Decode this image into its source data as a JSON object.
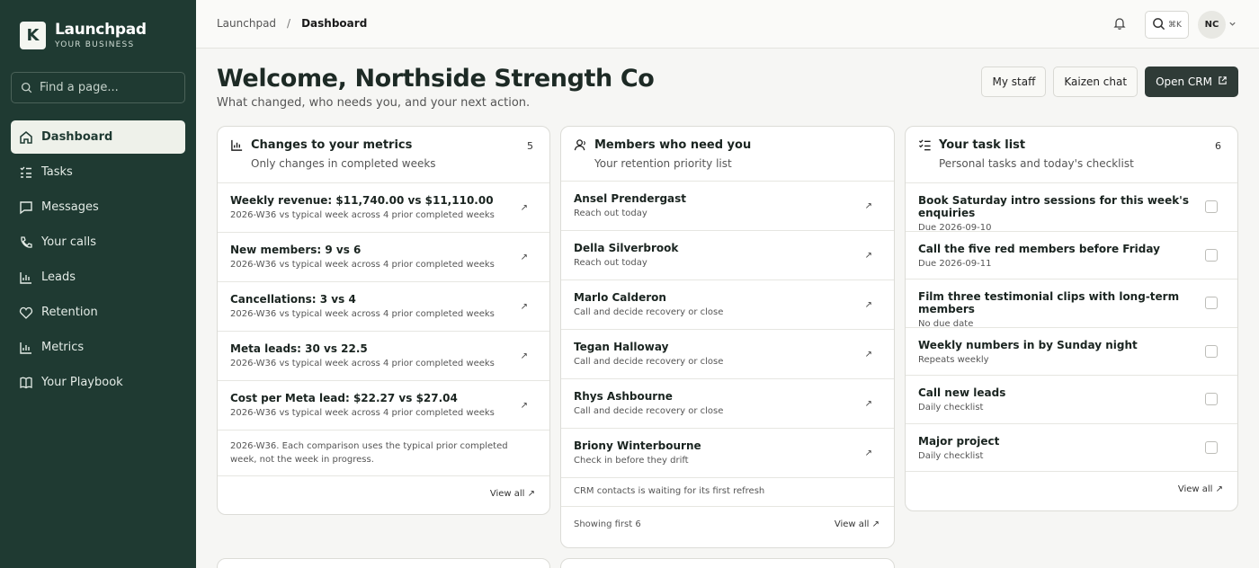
{
  "brand": {
    "logo_letter": "K",
    "name": "Launchpad",
    "tagline": "YOUR BUSINESS"
  },
  "sidebar": {
    "search_placeholder": "Find a page...",
    "items": [
      {
        "label": "Dashboard",
        "icon": "home-icon",
        "active": true
      },
      {
        "label": "Tasks",
        "icon": "tasks-icon"
      },
      {
        "label": "Messages",
        "icon": "message-icon"
      },
      {
        "label": "Your calls",
        "icon": "phone-icon"
      },
      {
        "label": "Leads",
        "icon": "bar-chart-icon"
      },
      {
        "label": "Retention",
        "icon": "heart-icon"
      },
      {
        "label": "Metrics",
        "icon": "bar-chart-icon"
      },
      {
        "label": "Your Playbook",
        "icon": "book-icon"
      }
    ]
  },
  "topbar": {
    "breadcrumb": [
      "Launchpad",
      "Dashboard"
    ],
    "separator": "/",
    "shortcut": "⌘K",
    "avatar_initials": "NC"
  },
  "header": {
    "title": "Welcome, Northside Strength Co",
    "subtitle": "What changed, who needs you, and your next action.",
    "buttons": [
      "My staff",
      "Kaizen chat",
      "Open CRM"
    ]
  },
  "metrics_card": {
    "title": "Changes to your metrics",
    "subtitle": "Only changes in completed weeks",
    "count": "5",
    "rows": [
      {
        "title": "Weekly revenue: $11,740.00 vs $11,110.00",
        "sub": "2026-W36 vs typical week across 4 prior completed weeks"
      },
      {
        "title": "New members: 9 vs 6",
        "sub": "2026-W36 vs typical week across 4 prior completed weeks"
      },
      {
        "title": "Cancellations: 3 vs 4",
        "sub": "2026-W36 vs typical week across 4 prior completed weeks"
      },
      {
        "title": "Meta leads: 30 vs 22.5",
        "sub": "2026-W36 vs typical week across 4 prior completed weeks"
      },
      {
        "title": "Cost per Meta lead: $22.27 vs $27.04",
        "sub": "2026-W36 vs typical week across 4 prior completed weeks"
      }
    ],
    "note": "2026-W36. Each comparison uses the typical prior completed week, not the week in progress.",
    "view_all": "View all"
  },
  "members_card": {
    "title": "Members who need you",
    "subtitle": "Your retention priority list",
    "rows": [
      {
        "title": "Ansel Prendergast",
        "sub": "Reach out today"
      },
      {
        "title": "Della Silverbrook",
        "sub": "Reach out today"
      },
      {
        "title": "Marlo Calderon",
        "sub": "Call and decide recovery or close"
      },
      {
        "title": "Tegan Halloway",
        "sub": "Call and decide recovery or close"
      },
      {
        "title": "Rhys Ashbourne",
        "sub": "Call and decide recovery or close"
      },
      {
        "title": "Briony Winterbourne",
        "sub": "Check in before they drift"
      }
    ],
    "notice": "CRM contacts is waiting for its first refresh",
    "showing": "Showing first 6",
    "view_all": "View all"
  },
  "tasks_card": {
    "title": "Your task list",
    "subtitle": "Personal tasks and today's checklist",
    "count": "6",
    "rows": [
      {
        "title": "Book Saturday intro sessions for this week's enquiries",
        "sub": "Due 2026-09-10"
      },
      {
        "title": "Call the five red members before Friday",
        "sub": "Due 2026-09-11"
      },
      {
        "title": "Film three testimonial clips with long-term members",
        "sub": "No due date"
      },
      {
        "title": "Weekly numbers in by Sunday night",
        "sub": "Repeats weekly"
      },
      {
        "title": "Call new leads",
        "sub": "Daily checklist"
      },
      {
        "title": "Major project",
        "sub": "Daily checklist"
      }
    ],
    "view_all": "View all"
  },
  "colors": {
    "sidebar_bg": "#1f3a32",
    "primary_dark": "#2f3b37",
    "background": "#f6f6f4"
  }
}
